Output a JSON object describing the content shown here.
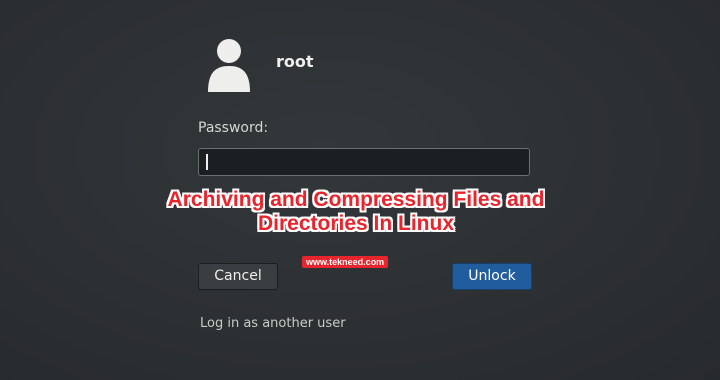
{
  "user": {
    "username": "root",
    "avatar_icon": "user-avatar-icon"
  },
  "password": {
    "label": "Password:",
    "value": ""
  },
  "buttons": {
    "cancel": "Cancel",
    "unlock": "Unlock"
  },
  "links": {
    "other_user": "Log in as another user"
  },
  "overlay": {
    "title_line1": "Archiving and Compressing Files and",
    "title_line2": "Directories In Linux",
    "site": "www.tekneed.com",
    "accent_color": "#e8242c"
  },
  "colors": {
    "unlock_button": "#215d9c",
    "background": "#2d3033"
  }
}
